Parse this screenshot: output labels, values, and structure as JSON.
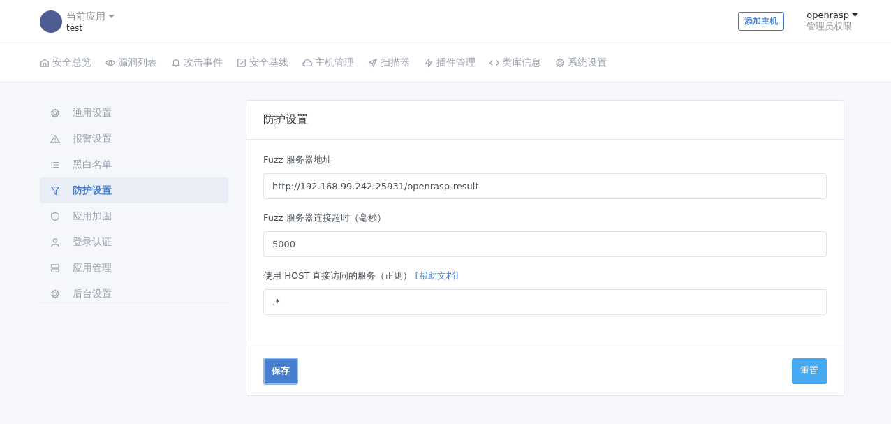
{
  "header": {
    "app_label": "当前应用",
    "app_name": "test",
    "add_host_button": "添加主机",
    "user_name": "openrasp",
    "user_role": "管理员权限"
  },
  "nav": [
    {
      "label": "安全总览",
      "kind": "home"
    },
    {
      "label": "漏洞列表",
      "kind": "eye"
    },
    {
      "label": "攻击事件",
      "kind": "bell"
    },
    {
      "label": "安全基线",
      "kind": "check"
    },
    {
      "label": "主机管理",
      "kind": "cloud"
    },
    {
      "label": "扫描器",
      "kind": "send"
    },
    {
      "label": "插件管理",
      "kind": "bolt"
    },
    {
      "label": "类库信息",
      "kind": "code"
    },
    {
      "label": "系统设置",
      "kind": "gear"
    }
  ],
  "sidebar": {
    "items": [
      {
        "label": "通用设置",
        "kind": "gear",
        "selected": false
      },
      {
        "label": "报警设置",
        "kind": "alert",
        "selected": false
      },
      {
        "label": "黑白名单",
        "kind": "list",
        "selected": false
      },
      {
        "label": "防护设置",
        "kind": "filter",
        "selected": true
      },
      {
        "label": "应用加固",
        "kind": "shield",
        "selected": false
      },
      {
        "label": "登录认证",
        "kind": "user",
        "selected": false
      },
      {
        "label": "应用管理",
        "kind": "server",
        "selected": false
      },
      {
        "label": "后台设置",
        "kind": "gear",
        "selected": false
      }
    ]
  },
  "card": {
    "title": "防护设置",
    "fields": [
      {
        "label": "Fuzz 服务器地址",
        "value": "http://192.168.99.242:25931/openrasp-result"
      },
      {
        "label": "Fuzz 服务器连接超时（毫秒）",
        "value": "5000"
      },
      {
        "label": "使用 HOST 直接访问的服务（正则）",
        "link": "[帮助文档]",
        "value": ".*"
      }
    ],
    "save_button": "保存",
    "reset_button": "重置"
  }
}
